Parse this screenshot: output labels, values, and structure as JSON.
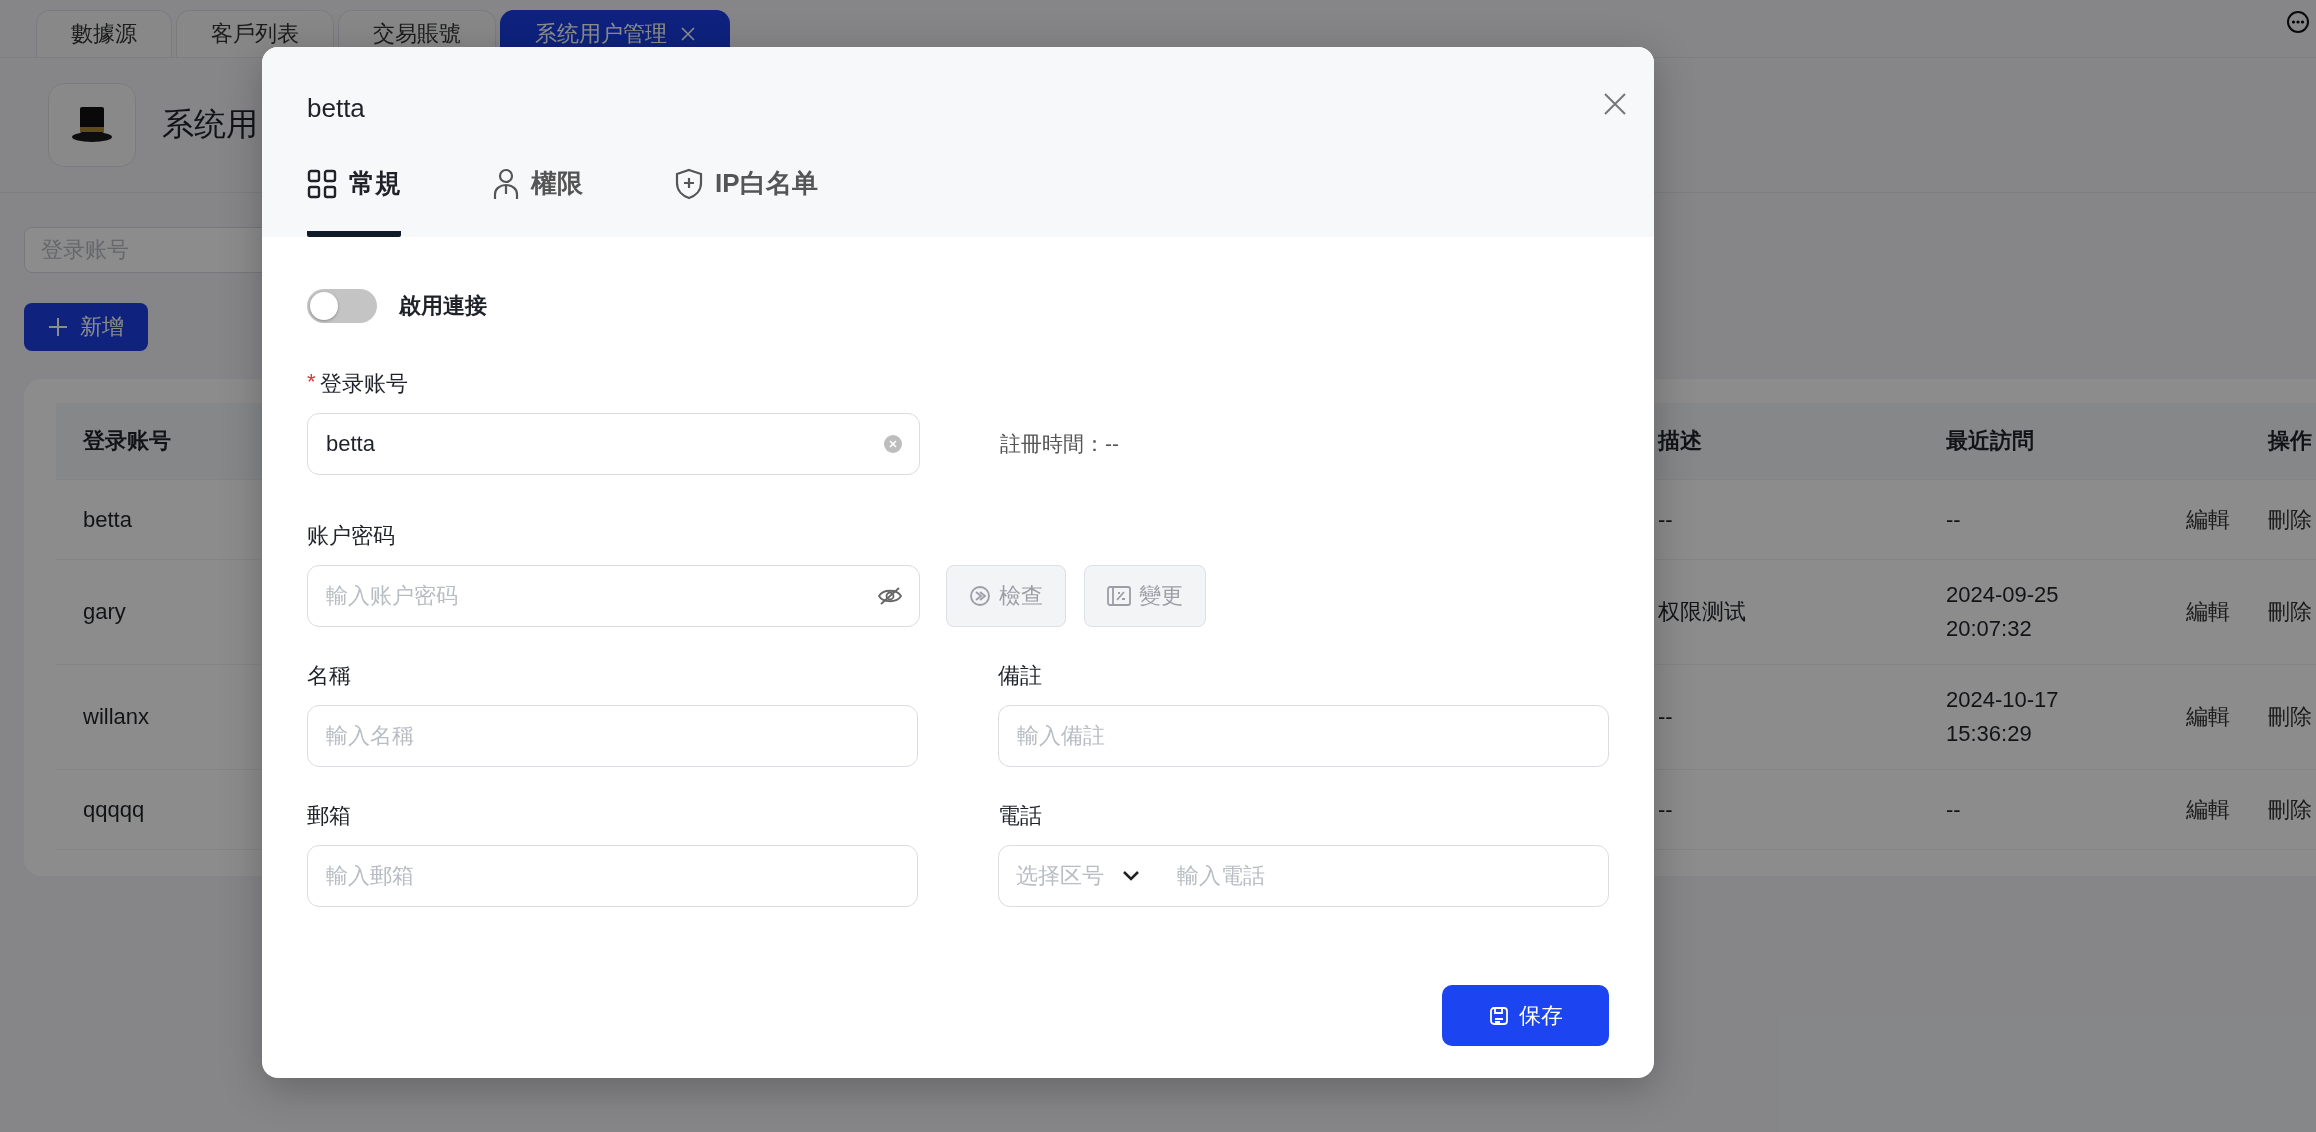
{
  "page_tabs": [
    {
      "label": "數據源",
      "selected": false,
      "closable": false
    },
    {
      "label": "客戶列表",
      "selected": false,
      "closable": false
    },
    {
      "label": "交易賬號",
      "selected": false,
      "closable": false
    },
    {
      "label": "系统用户管理",
      "selected": true,
      "closable": true
    }
  ],
  "header": {
    "title": "系统用"
  },
  "search": {
    "placeholder": "登录账号"
  },
  "add_button": "新增",
  "table": {
    "columns": [
      "登录账号",
      "描述",
      "最近訪問",
      "操作"
    ],
    "rows": [
      {
        "account": "betta",
        "description": "--",
        "last_visit": "--",
        "actions": [
          "編輯",
          "刪除"
        ]
      },
      {
        "account": "gary",
        "description": "权限测试",
        "last_visit": "2024-09-25 20:07:32",
        "actions": [
          "編輯",
          "刪除"
        ]
      },
      {
        "account": "willanx",
        "description": "--",
        "last_visit": "2024-10-17 15:36:29",
        "actions": [
          "編輯",
          "刪除"
        ]
      },
      {
        "account": "qqqqq",
        "description": "--",
        "last_visit": "--",
        "actions": [
          "編輯",
          "刪除"
        ]
      }
    ]
  },
  "dialog": {
    "title": "betta",
    "tabs": [
      {
        "label": "常規",
        "selected": true
      },
      {
        "label": "權限",
        "selected": false
      },
      {
        "label": "IP白名单",
        "selected": false
      }
    ],
    "toggle": {
      "label": "啟用連接",
      "on": false
    },
    "account": {
      "label": "登录账号",
      "required_mark": "*",
      "value": "betta"
    },
    "registered": "註冊時間：--",
    "password": {
      "label": "账户密码",
      "placeholder": "輸入账户密码",
      "buttons": [
        {
          "label": "檢查",
          "disabled": true
        },
        {
          "label": "變更",
          "disabled": true
        }
      ]
    },
    "name": {
      "label": "名稱",
      "placeholder": "輸入名稱"
    },
    "remark": {
      "label": "備註",
      "placeholder": "輸入備註"
    },
    "email": {
      "label": "郵箱",
      "placeholder": "輸入郵箱"
    },
    "phone": {
      "label": "電話",
      "code_placeholder": "选择区号",
      "placeholder": "輸入電話"
    },
    "save": "保存"
  }
}
